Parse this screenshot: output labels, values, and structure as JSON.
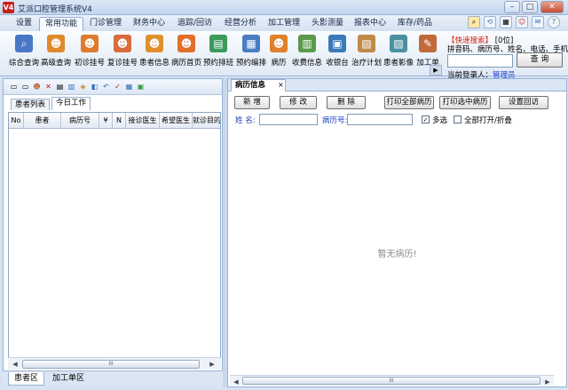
{
  "window": {
    "title": "艾派口腔管理系统V4",
    "app_icon": "V4"
  },
  "menu": {
    "tabs": [
      {
        "label": "设置"
      },
      {
        "label": "常用功能"
      },
      {
        "label": "门诊管理"
      },
      {
        "label": "财务中心"
      },
      {
        "label": "追踪/回访"
      },
      {
        "label": "经营分析"
      },
      {
        "label": "加工管理"
      },
      {
        "label": "头影测量"
      },
      {
        "label": "报表中心"
      },
      {
        "label": "库存/药品"
      }
    ],
    "active": "常用功能"
  },
  "ribbon": {
    "buttons": [
      {
        "label": "综合查询",
        "icon": "magnifier-icon",
        "color": "#4a78c8"
      },
      {
        "label": "高级查询",
        "icon": "person-search-icon",
        "color": "#e08a2c"
      },
      {
        "label": "初诊挂号",
        "icon": "person-add-icon",
        "color": "#e07a2c"
      },
      {
        "label": "复诊挂号",
        "icon": "person-return-icon",
        "color": "#d86c3a"
      },
      {
        "label": "患者信息",
        "icon": "patient-info-icon",
        "color": "#e0902c"
      },
      {
        "label": "病历首页",
        "icon": "record-home-icon",
        "color": "#e0702c"
      },
      {
        "label": "预约排班",
        "icon": "schedule-icon",
        "color": "#3c9a5a"
      },
      {
        "label": "预约编排",
        "icon": "arrange-icon",
        "color": "#4a7ec0"
      },
      {
        "label": "病历",
        "icon": "record-icon",
        "color": "#e0802c"
      },
      {
        "label": "收费信息",
        "icon": "billing-icon",
        "color": "#5a9a4a"
      },
      {
        "label": "收银台",
        "icon": "cashier-icon",
        "color": "#3a7ab8"
      },
      {
        "label": "治疗计划",
        "icon": "treatment-plan-icon",
        "color": "#c08a4a"
      },
      {
        "label": "患者影像",
        "icon": "image-icon",
        "color": "#4a90a0"
      },
      {
        "label": "加工单",
        "icon": "processing-order-icon",
        "color": "#c06a3a"
      }
    ]
  },
  "quick_search": {
    "title": "【快速搜索】",
    "count": "[0位]",
    "hint": "拼音码、病历号、姓名、电话、手机",
    "input_value": "",
    "button": "查 询",
    "user_label": "当前登录人：",
    "user_name": "管理员"
  },
  "left_panel": {
    "tabs": [
      {
        "label": "患者列表"
      },
      {
        "label": "今日工作"
      }
    ],
    "active_tab": "今日工作",
    "columns": [
      "No",
      "患者",
      "病历号",
      "¥",
      "N",
      "接诊医生",
      "希望医生",
      "就诊目的"
    ],
    "rows": [],
    "bottom_tabs": [
      {
        "label": "患者区"
      },
      {
        "label": "加工单区"
      }
    ],
    "scroll_grip": "III"
  },
  "right_panel": {
    "tab": "病历信息",
    "tab_close": "×",
    "buttons": {
      "add": "新 增",
      "edit": "修 改",
      "delete": "删 除",
      "print_all": "打印全部病历",
      "print_selected": "打印选中病历",
      "set_followup": "设置回访"
    },
    "name_label": "姓 名:",
    "name_value": "",
    "record_no_label": "病历号:",
    "record_no_value": "",
    "multi_select": "多选",
    "multi_select_checked": true,
    "expand_all": "全部打开/折叠",
    "expand_all_checked": false,
    "empty_text": "暂无病历!",
    "scroll_grip": "III"
  }
}
